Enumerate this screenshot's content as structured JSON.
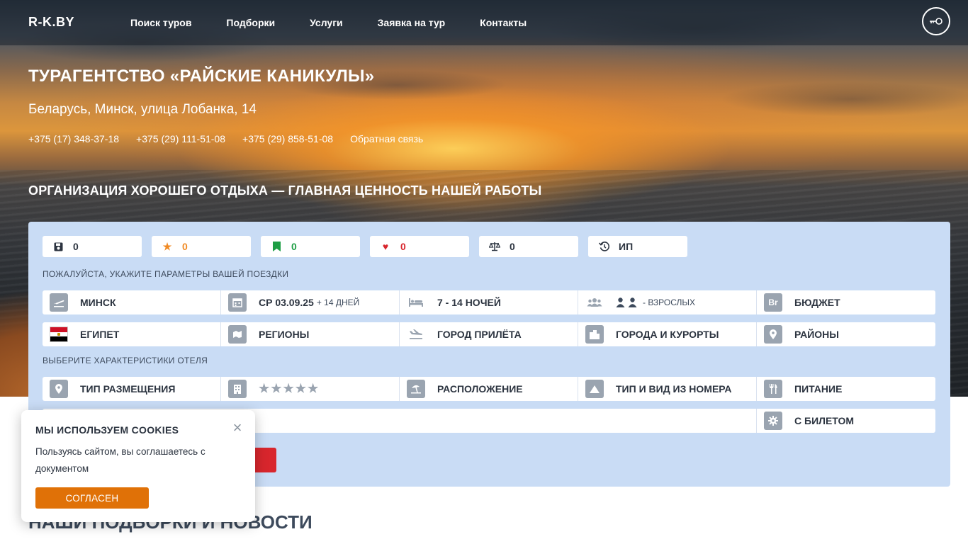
{
  "header": {
    "logo": "R-K.BY",
    "nav": [
      "Поиск туров",
      "Подборки",
      "Услуги",
      "Заявка на тур",
      "Контакты"
    ],
    "login_icon": "key-icon"
  },
  "agency": {
    "title": "ТУРАГЕНТСТВО «РАЙСКИЕ КАНИКУЛЫ»",
    "address": "Беларусь, Минск, улица Лобанка, 14",
    "phones": [
      "+375 (17) 348-37-18",
      "+375 (29) 111-51-08",
      "+375 (29) 858-51-08"
    ],
    "feedback": "Обратная связь",
    "tagline": "ОРГАНИЗАЦИЯ ХОРОШЕГО ОТДЫХА — ГЛАВНАЯ ЦЕННОСТЬ НАШЕЙ РАБОТЫ"
  },
  "counters": [
    {
      "icon": "save-icon",
      "value": "0",
      "color": "#2c3440"
    },
    {
      "icon": "star-icon",
      "value": "0",
      "color": "#f08a24"
    },
    {
      "icon": "bookmark-icon",
      "value": "0",
      "color": "#1e9e45"
    },
    {
      "icon": "heart-icon",
      "value": "0",
      "color": "#d8262d"
    },
    {
      "icon": "scales-icon",
      "value": "0",
      "color": "#2c3440"
    },
    {
      "icon": "history-icon",
      "value": "ИП",
      "color": "#2c3440"
    }
  ],
  "search": {
    "trip_label": "ПОЖАЛУЙСТА, УКАЖИТЕ ПАРАМЕТРЫ ВАШЕЙ ПОЕЗДКИ",
    "departure": "МИНСК",
    "date": "СР 03.09.25",
    "date_extra": "+ 14 ДНЕЙ",
    "nights": "7 - 14 НОЧЕЙ",
    "adults": "- ВЗРОСЛЫХ",
    "budget": "БЮДЖЕТ",
    "budget_icon_text": "Br",
    "country": "ЕГИПЕТ",
    "regions": "РЕГИОНЫ",
    "arrival_city": "ГОРОД ПРИЛЁТА",
    "cities": "ГОРОДА И КУРОРТЫ",
    "districts": "РАЙОНЫ",
    "hotel_label": "ВЫБЕРИТЕ ХАРАКТЕРИСТИКИ ОТЕЛЯ",
    "accommodation": "ТИП РАЗМЕЩЕНИЯ",
    "stars": "★★★★★",
    "location": "РАСПОЛОЖЕНИЕ",
    "room": "ТИП И ВИД ИЗ НОМЕРА",
    "meals": "ПИТАНИЕ",
    "ticket": "С БИЛЕТОМ"
  },
  "news_title": "НАШИ ПОДБОРКИ И НОВОСТИ",
  "cookie": {
    "title": "МЫ ИСПОЛЬЗУЕМ COOKIES",
    "text": "Пользуясь сайтом, вы соглашаетесь с документом",
    "agree": "СОГЛАСЕН",
    "close": "×"
  },
  "colors": {
    "accent_orange": "#e07107",
    "search_red": "#d8262d",
    "panel_bg": "#c9dcf5"
  }
}
